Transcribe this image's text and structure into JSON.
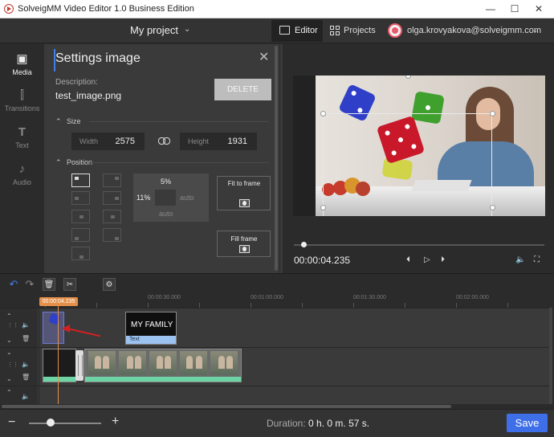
{
  "window": {
    "title": "SolveigMM Video Editor 1.0 Business Edition",
    "minimize": "—",
    "maximize": "☐",
    "close": "✕"
  },
  "header": {
    "project_name": "My project",
    "tab_editor": "Editor",
    "tab_projects": "Projects",
    "user_email": "olga.krovyakova@solveigmm.com"
  },
  "sidebar": {
    "items": [
      {
        "label": "Media",
        "icon": "image-icon",
        "active": true
      },
      {
        "label": "Transitions",
        "icon": "transitions-icon",
        "active": false
      },
      {
        "label": "Text",
        "icon": "text-icon",
        "active": false
      },
      {
        "label": "Audio",
        "icon": "music-note-icon",
        "active": false
      }
    ]
  },
  "settings": {
    "title": "Settings image",
    "description_label": "Description:",
    "file_name": "test_image.png",
    "delete_label": "DELETE",
    "size_section": "Size",
    "width_label": "Width",
    "width_value": "2575",
    "height_label": "Height",
    "height_value": "1931",
    "position_section": "Position",
    "margin_top": "5%",
    "margin_left": "11%",
    "margin_right": "auto",
    "margin_bottom": "auto",
    "fit_to_frame": "Fit to frame",
    "fill_frame": "Fill frame"
  },
  "preview": {
    "timecode": "00:00:04.235",
    "seek_position": 0.03
  },
  "timeline": {
    "playhead_time": "00:00:04.235",
    "ruler_marks": [
      "00:00:30.000",
      "00:01:00.000",
      "00:01:30.000",
      "00:02:00.000"
    ],
    "text_clip_title": "MY FAMILY",
    "text_clip_label": "Text"
  },
  "bottom": {
    "duration_label": "Duration:",
    "duration_value": "0 h. 0 m. 57 s.",
    "save_label": "Save",
    "zoom_level": 0.3
  },
  "colors": {
    "accent": "#3f6fe8",
    "playhead": "#e5904a",
    "audio_wave": "#6dd5a5",
    "annotation_arrow": "#d42020"
  }
}
